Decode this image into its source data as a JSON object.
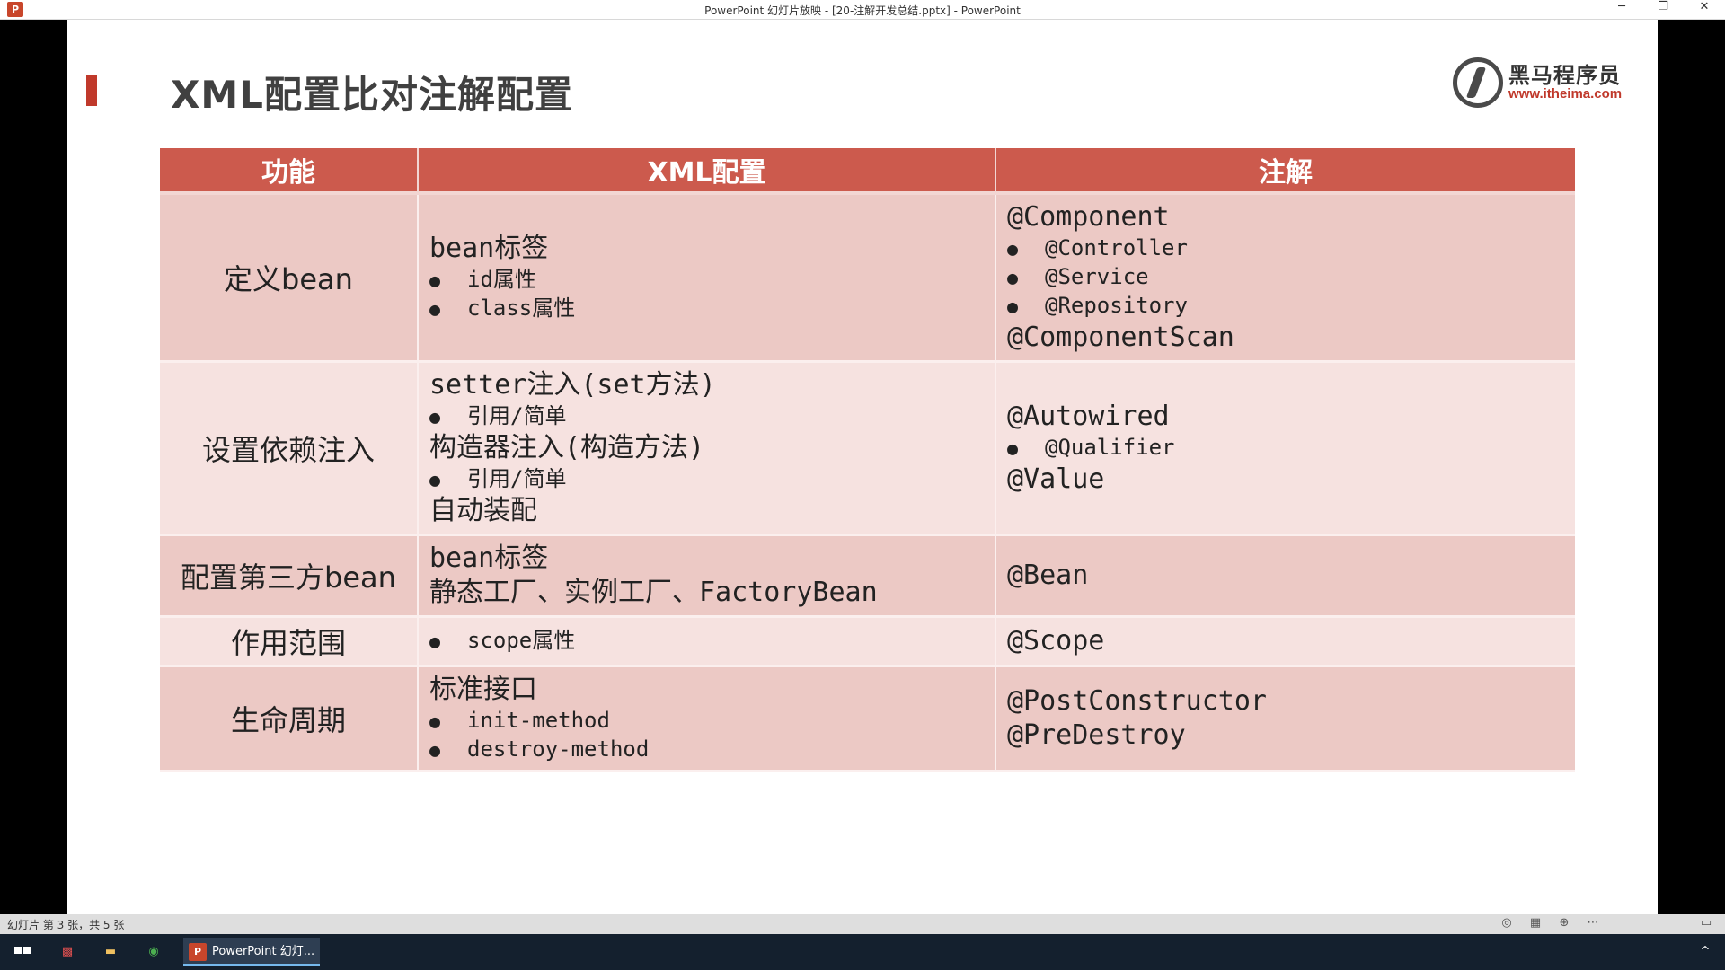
{
  "window": {
    "title": "PowerPoint 幻灯片放映 - [20-注解开发总结.pptx] - PowerPoint",
    "app_icon": "P",
    "minimize": "─",
    "restore": "❐",
    "close": "✕"
  },
  "slide": {
    "title": "XML配置比对注解配置",
    "logo": {
      "name_cn": "黑马程序员",
      "url": "www.itheima.com"
    },
    "table": {
      "headers": [
        "功能",
        "XML配置",
        "注解"
      ],
      "rows": [
        {
          "func": "定义bean",
          "xml": [
            {
              "t": "big",
              "text": "bean标签"
            },
            {
              "t": "bul",
              "text": "id属性"
            },
            {
              "t": "bul",
              "text": "class属性"
            }
          ],
          "anno": [
            {
              "t": "big",
              "text": "@Component"
            },
            {
              "t": "bul",
              "text": "@Controller"
            },
            {
              "t": "bul",
              "text": "@Service"
            },
            {
              "t": "bul",
              "text": "@Repository"
            },
            {
              "t": "big",
              "text": "@ComponentScan"
            }
          ]
        },
        {
          "func": "设置依赖注入",
          "xml": [
            {
              "t": "big",
              "text": "setter注入(set方法)"
            },
            {
              "t": "bul",
              "text": "引用/简单"
            },
            {
              "t": "big",
              "text": "构造器注入(构造方法)"
            },
            {
              "t": "bul",
              "text": "引用/简单"
            },
            {
              "t": "big",
              "text": "自动装配"
            }
          ],
          "anno": [
            {
              "t": "big",
              "text": "@Autowired"
            },
            {
              "t": "bul",
              "text": "@Qualifier"
            },
            {
              "t": "big",
              "text": "@Value"
            }
          ]
        },
        {
          "func": "配置第三方bean",
          "xml": [
            {
              "t": "big",
              "text": "bean标签"
            },
            {
              "t": "big",
              "text": "静态工厂、实例工厂、FactoryBean"
            }
          ],
          "anno": [
            {
              "t": "big",
              "text": "@Bean"
            }
          ]
        },
        {
          "func": "作用范围",
          "xml": [
            {
              "t": "bul",
              "text": "scope属性"
            }
          ],
          "anno": [
            {
              "t": "big",
              "text": "@Scope"
            }
          ]
        },
        {
          "func": "生命周期",
          "xml": [
            {
              "t": "big",
              "text": "标准接口"
            },
            {
              "t": "bul",
              "text": "init-method"
            },
            {
              "t": "bul",
              "text": "destroy-method"
            }
          ],
          "anno": [
            {
              "t": "big",
              "text": "@PostConstructor"
            },
            {
              "t": "big",
              "text": "@PreDestroy"
            }
          ]
        }
      ]
    }
  },
  "status": {
    "slide_info": "幻灯片 第 3 张，共 5 张"
  },
  "taskbar": {
    "active_app_label": "PowerPoint 幻灯...",
    "active_app_icon": "P"
  },
  "colors": {
    "header_bg": "#cc5a4d",
    "row_dark": "#ecc9c5",
    "row_light": "#f6e2e0",
    "accent": "#c0392b"
  }
}
